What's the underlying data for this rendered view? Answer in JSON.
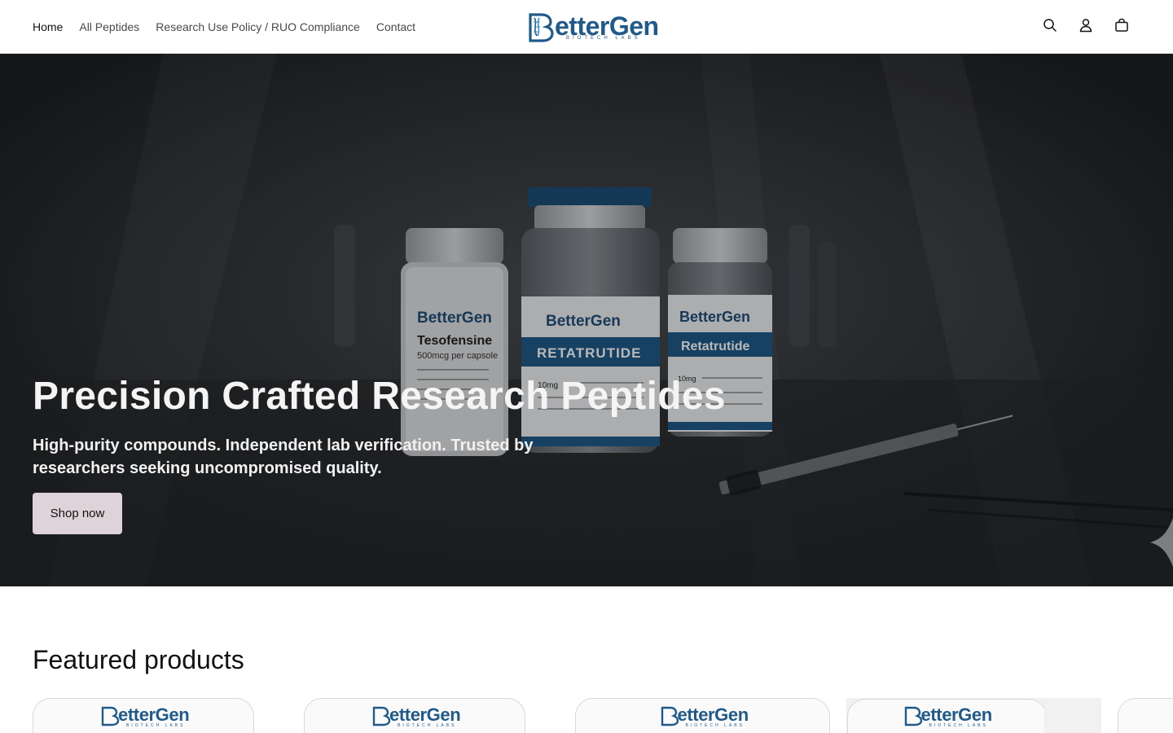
{
  "nav": {
    "items": [
      {
        "label": "Home"
      },
      {
        "label": "All Peptides"
      },
      {
        "label": "Research Use Policy / RUO Compliance"
      },
      {
        "label": "Contact"
      }
    ]
  },
  "brand": {
    "name": "BetterGen",
    "name_rest": "etterGen",
    "tagline": "BIOTECH LABS",
    "color": "#1f5a8a"
  },
  "header_icons": [
    "search-icon",
    "account-icon",
    "cart-icon"
  ],
  "hero": {
    "title": "Precision Crafted Research Peptides",
    "subtitle": "High-purity compounds. Independent lab verification. Trusted by researchers seeking uncompromised quality.",
    "button": "Shop now",
    "vials": [
      {
        "brand": "etterGen",
        "name": "Tesofensine",
        "dose": "500mcg per capsole"
      },
      {
        "brand": "etterGen",
        "name": "RETATRUTIDE",
        "dose": "10mg"
      },
      {
        "brand": "etterGen",
        "name": "Retatrutide",
        "dose": "10mg"
      }
    ]
  },
  "featured": {
    "title": "Featured products",
    "cards": [
      {
        "brand": "etterGen",
        "tagline": "BIOTECH LABS"
      },
      {
        "brand": "etterGen",
        "tagline": "BIOTECH LABS"
      },
      {
        "brand": "etterGen",
        "tagline": "BIOTECH LABS"
      },
      {
        "brand": "etterGen",
        "tagline": "BIOTECH LABS"
      }
    ]
  }
}
